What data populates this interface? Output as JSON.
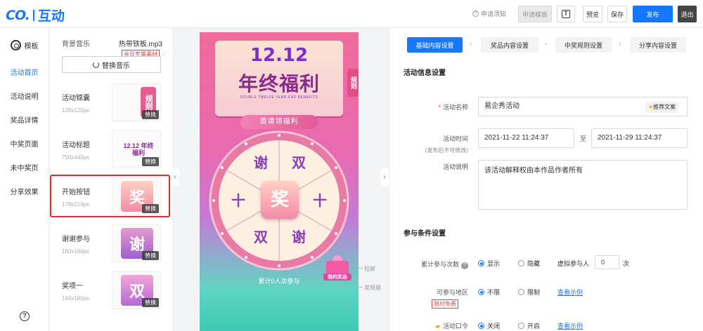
{
  "header": {
    "logo_text": "互动",
    "notice": "申请须知",
    "apply_template": "申请模板",
    "preview": "预览",
    "save": "保存",
    "publish": "发布",
    "exit": "退出"
  },
  "leftnav": {
    "template": "模板",
    "items": [
      "活动首页",
      "活动说明",
      "奖品详情",
      "中奖页面",
      "未中奖页",
      "分享效果"
    ],
    "help": "?"
  },
  "assets": {
    "music_label": "背景音乐",
    "music_file": "热带铁板.mp3",
    "member_tag": "会员专属素材",
    "replace_music": "替换音乐",
    "replace": "替换",
    "items": [
      {
        "name": "活动锦囊",
        "size": "120x120px",
        "art": "规则"
      },
      {
        "name": "活动标题",
        "size": "750x440px",
        "art": "12.12 年终福利"
      },
      {
        "name": "开始按钮",
        "size": "179x219px",
        "art": "奖"
      },
      {
        "name": "谢谢参与",
        "size": "160x160px",
        "art": "谢"
      },
      {
        "name": "奖项一",
        "size": "160x160px",
        "art": "双"
      }
    ]
  },
  "preview": {
    "date": "12.12",
    "title": "年终福利",
    "subtitle": "DOUBLE TWELVE YEAR-END BENEFITS",
    "rules": "规则",
    "invite": "邀请领福利",
    "start": "奖",
    "segments": [
      "谢",
      "双",
      "十",
      "十",
      "谢",
      "双"
    ],
    "counter": "累计0人次参与",
    "gift_label": "我的奖品",
    "short_screen": "短屏",
    "normal_screen": "常规屏"
  },
  "steps": [
    "基础内容设置",
    "奖品内容设置",
    "中奖规则设置",
    "分享内容设置"
  ],
  "form": {
    "section_info": "活动信息设置",
    "name_label": "活动名称",
    "name_value": "易企秀活动",
    "recommend": "推荐文案",
    "time_label": "活动时间",
    "time_note": "(发布后不可修改)",
    "start_time": "2021-11-22 11:24:37",
    "to": "至",
    "end_time": "2021-11-29 11:24:37",
    "desc_label": "活动说明",
    "desc_value": "该活动解释权由本作品作者所有",
    "section_join": "参与条件设置",
    "count_label": "累计参与次数",
    "show": "显示",
    "hide": "隐藏",
    "virtual_label": "虚拟参与人",
    "virtual_value": "0",
    "virtual_unit": "次",
    "region_label": "可参与地区",
    "unlimited": "不限",
    "limited": "限制",
    "view_example": "查看示例",
    "limited_free": "限时免费",
    "password_label": "活动口令",
    "off": "关闭",
    "on": "开启"
  },
  "colors": {
    "primary": "#1677ff",
    "danger": "#e8262b"
  }
}
